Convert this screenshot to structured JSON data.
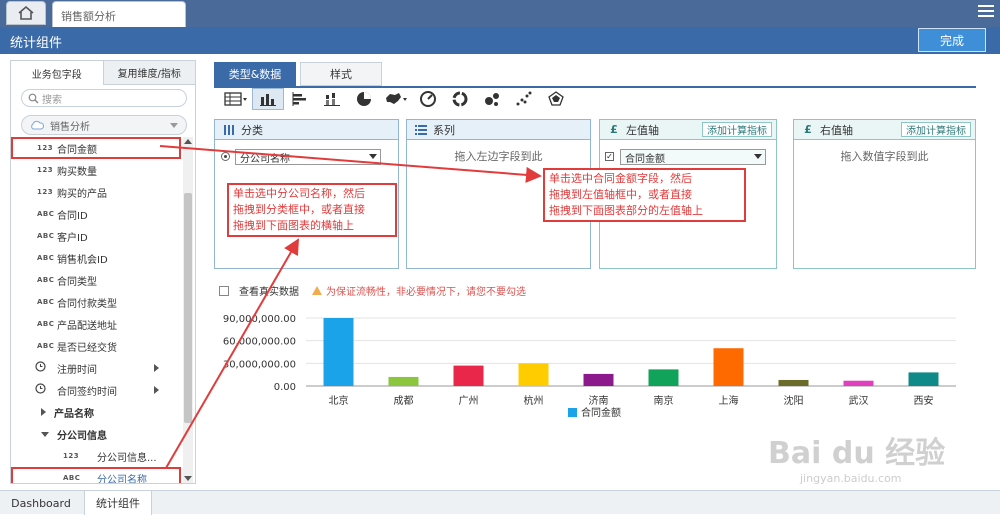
{
  "top": {
    "doc_tab": "销售额分析"
  },
  "title_bar": {
    "title": "统计组件",
    "done_label": "完成"
  },
  "left_panel": {
    "tabs": [
      "业务包字段",
      "复用维度/指标"
    ],
    "search_placeholder": "搜索",
    "package": "销售分析",
    "fields": [
      {
        "type": "123",
        "name": "合同金额"
      },
      {
        "type": "123",
        "name": "购买数量"
      },
      {
        "type": "123",
        "name": "购买的产品"
      },
      {
        "type": "ABC",
        "name": "合同ID"
      },
      {
        "type": "ABC",
        "name": "客户ID"
      },
      {
        "type": "ABC",
        "name": "销售机会ID"
      },
      {
        "type": "ABC",
        "name": "合同类型"
      },
      {
        "type": "ABC",
        "name": "合同付款类型"
      },
      {
        "type": "ABC",
        "name": "产品配送地址"
      },
      {
        "type": "ABC",
        "name": "是否已经交货"
      },
      {
        "type": "clock",
        "name": "注册时间"
      },
      {
        "type": "clock",
        "name": "合同签约时间"
      }
    ],
    "groups": [
      "产品名称",
      "分公司信息"
    ],
    "sub_fields": [
      {
        "type": "123",
        "name": "分公司信息..."
      },
      {
        "type": "ABC",
        "name": "分公司名称"
      }
    ]
  },
  "main_tabs": [
    "类型&数据",
    "样式"
  ],
  "zones": {
    "category": {
      "title": "分类",
      "field": "分公司名称"
    },
    "series": {
      "title": "系列",
      "hint": "拖入左边字段到此"
    },
    "left_axis": {
      "title": "左值轴",
      "calc": "添加计算指标",
      "field": "合同金额"
    },
    "right_axis": {
      "title": "右值轴",
      "calc": "添加计算指标",
      "hint": "拖入数值字段到此"
    }
  },
  "notes": {
    "left": [
      "单击选中分公司名称，然后",
      "拖拽到分类框中，或者直接",
      "拖拽到下面图表的横轴上"
    ],
    "right": [
      "单击选中合同金额字段，然后",
      "拖拽到左值轴框中，或者直接",
      "拖拽到下面图表部分的左值轴上"
    ]
  },
  "show_data_label": "查看真实数据",
  "warning": "为保证流畅性，非必要情况下，请您不要勾选",
  "chart_data": {
    "type": "bar",
    "categories": [
      "北京",
      "成都",
      "广州",
      "杭州",
      "济南",
      "南京",
      "上海",
      "沈阳",
      "武汉",
      "西安"
    ],
    "series": [
      {
        "name": "合同金额",
        "values": [
          90000000,
          12000000,
          27000000,
          30000000,
          16000000,
          22000000,
          50000000,
          8000000,
          7000000,
          18000000
        ]
      }
    ],
    "colors": [
      "#1aa3e8",
      "#8cc63e",
      "#e8274b",
      "#ffcc00",
      "#8c1a8c",
      "#12a35a",
      "#ff6a00",
      "#6b6b2a",
      "#e040c0",
      "#0f8a88"
    ],
    "ylim": [
      0,
      90000000
    ],
    "yticks": [
      "0.00",
      "30,000,000.00",
      "60,000,000.00",
      "90,000,000.00"
    ],
    "yticks_values": [
      0,
      30000000,
      60000000,
      90000000
    ],
    "legend": "bottom",
    "grid": true
  },
  "bottom_tabs": [
    "Dashboard",
    "统计组件"
  ],
  "watermark": {
    "main": "Bai du 经验",
    "sub": "jingyan.baidu.com"
  }
}
